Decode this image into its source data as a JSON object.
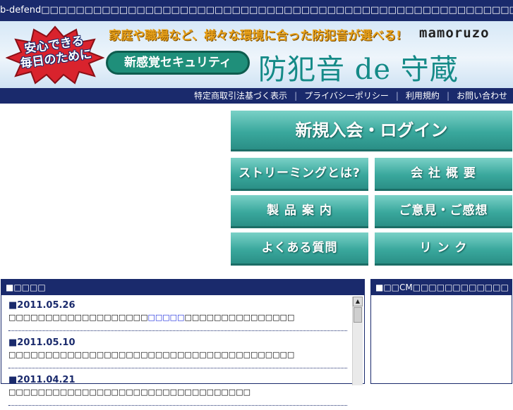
{
  "top_bar": {
    "text": "b-defend□□□□□□□□□□□□□□□□□□□□□□□□□□□□□□□□□□□□□□□□□□□□□□□□□□□□□□□□□□□□□□"
  },
  "banner": {
    "badge_line1": "安心できる",
    "badge_line2": "毎日のために",
    "tagline": "家庭や職場など、様々な環境に合った防犯音が選べる!",
    "logo_latin": "mamoruzo",
    "pill_text": "新感覚セキュリティ",
    "brand_name": "防犯音 de 守蔵"
  },
  "nav": {
    "links": [
      "特定商取引法基づく表示",
      "プライバシーポリシー",
      "利用規約",
      "お問い合わせ"
    ]
  },
  "menu": {
    "primary": "新規入会・ログイン",
    "buttons": [
      "ストリーミングとは?",
      "会 社 概 要",
      "製 品 案 内",
      "ご意見・ご感想",
      "よくある質問",
      "リ ン ク"
    ]
  },
  "news": {
    "heading": "■□□□□",
    "items": [
      {
        "date": "■2011.05.26",
        "pre": "□□□□□□□□□□□□□□□□□□□",
        "link": "□□□□□",
        "post": "□□□□□□□□□□□□□□□"
      },
      {
        "date": "■2011.05.10",
        "text": "□□□□□□□□□□□□□□□□□□□□□□□□□□□□□□□□□□□□□□□"
      },
      {
        "date": "■2011.04.21",
        "text": "□□□□□□□□□□□□□□□□□□□□□□□□□□□□□□□□□"
      }
    ]
  },
  "cm": {
    "heading": "■□□CM□□□□□□□□□□□□"
  },
  "colors": {
    "navy": "#1a2a6c",
    "teal": "#3aa89d",
    "badge_red": "#d9232d",
    "tagline_orange": "#e8a11a"
  }
}
